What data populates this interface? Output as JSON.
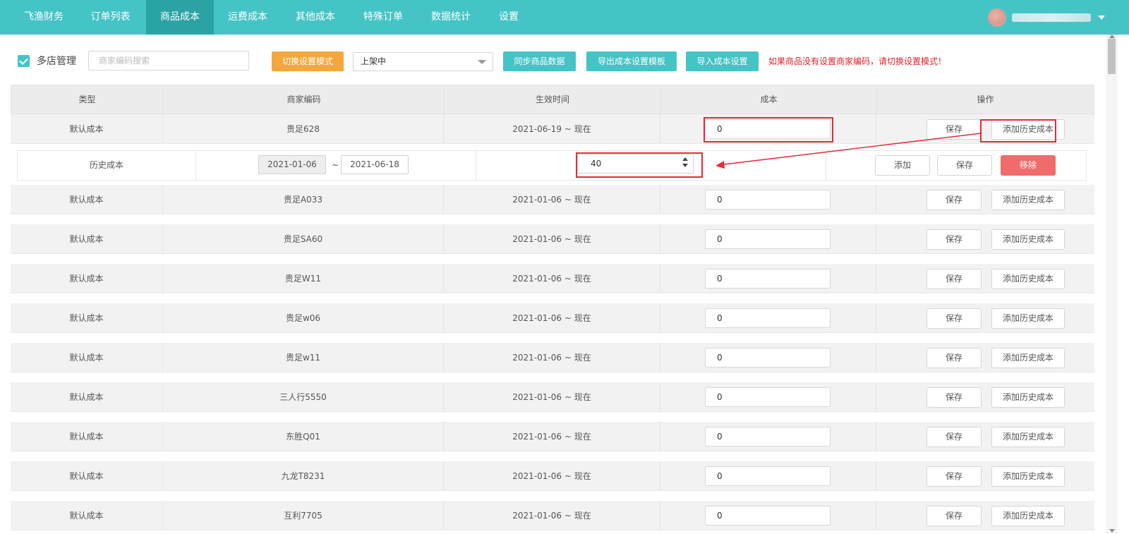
{
  "nav": {
    "tabs": [
      "飞渔财务",
      "订单列表",
      "商品成本",
      "运费成本",
      "其他成本",
      "特殊订单",
      "数据统计",
      "设置"
    ],
    "active": "商品成本"
  },
  "toolbar": {
    "multi_store_label": "多店管理",
    "search_placeholder": "商家编码搜索",
    "switch_mode": "切换设置模式",
    "status_select": "上架中",
    "sync": "同步商品数据",
    "export": "导出成本设置模板",
    "import": "导入成本设置",
    "warning": "如果商品没有设置商家编码，请切换设置模式！"
  },
  "table": {
    "headers": [
      "类型",
      "商家编码",
      "生效时间",
      "成本",
      "操作"
    ],
    "save": "保存",
    "add_history": "添加历史成本",
    "rows": [
      {
        "type": "默认成本",
        "code": "贵足628",
        "time": "2021-06-19 ~ 现在",
        "cost": "0"
      },
      {
        "type": "默认成本",
        "code": "贵足A033",
        "time": "2021-01-06 ~ 现在",
        "cost": "0"
      },
      {
        "type": "默认成本",
        "code": "贵足SA60",
        "time": "2021-01-06 ~ 现在",
        "cost": "0"
      },
      {
        "type": "默认成本",
        "code": "贵足W11",
        "time": "2021-01-06 ~ 现在",
        "cost": "0"
      },
      {
        "type": "默认成本",
        "code": "贵足w06",
        "time": "2021-01-06 ~ 现在",
        "cost": "0"
      },
      {
        "type": "默认成本",
        "code": "贵足w11",
        "time": "2021-01-06 ~ 现在",
        "cost": "0"
      },
      {
        "type": "默认成本",
        "code": "三人行5550",
        "time": "2021-01-06 ~ 现在",
        "cost": "0"
      },
      {
        "type": "默认成本",
        "code": "东胜Q01",
        "time": "2021-01-06 ~ 现在",
        "cost": "0"
      },
      {
        "type": "默认成本",
        "code": "九龙T8231",
        "time": "2021-01-06 ~ 现在",
        "cost": "0"
      },
      {
        "type": "默认成本",
        "code": "互利7705",
        "time": "2021-01-06 ~ 现在",
        "cost": "0"
      }
    ]
  },
  "history": {
    "type": "历史成本",
    "start": "2021-01-06",
    "sep": "~",
    "end": "2021-06-18",
    "cost": "40",
    "add": "添加",
    "save": "保存",
    "remove": "移除"
  },
  "colors": {
    "accent": "#45c4c6",
    "orange": "#f4a73b",
    "danger": "#f06b6b",
    "warning": "#e0212b"
  }
}
